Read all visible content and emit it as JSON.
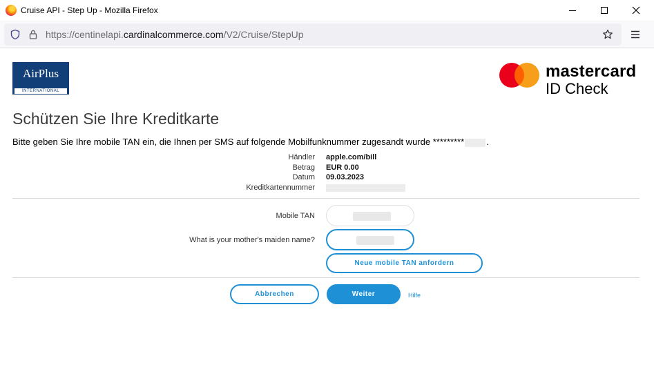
{
  "window": {
    "title": "Cruise API - Step Up - Mozilla Firefox"
  },
  "browser": {
    "url_prefix": "https://centinelapi.",
    "url_domain": "cardinalcommerce.com",
    "url_path": "/V2/Cruise/StepUp"
  },
  "logos": {
    "airplus_name": "AirPlus",
    "airplus_sub": "INTERNATIONAL",
    "mastercard_word": "mastercard",
    "mastercard_product": "ID Check",
    "mc_red": "#eb001b",
    "mc_orange": "#f79e1b",
    "mc_overlap": "#ff5f00"
  },
  "page": {
    "title": "Schützen Sie Ihre Kreditkarte",
    "instruction": "Bitte geben Sie Ihre mobile TAN ein, die Ihnen per SMS auf folgende Mobilfunknummer zugesandt wurde *********",
    "instruction_end": "."
  },
  "details": {
    "merchant_label": "Händler",
    "merchant_value": "apple.com/bill",
    "amount_label": "Betrag",
    "amount_value": "EUR 0.00",
    "date_label": "Datum",
    "date_value": "09.03.2023",
    "card_label": "Kreditkartennummer"
  },
  "form": {
    "tan_label": "Mobile TAN",
    "maiden_label": "What is your mother's maiden name?",
    "new_tan_button": "Neue mobile TAN anfordern",
    "cancel_button": "Abbrechen",
    "continue_button": "Weiter",
    "help_link": "Hilfe"
  },
  "colors": {
    "accent": "#1e90d6",
    "airplus_blue": "#123f78"
  }
}
